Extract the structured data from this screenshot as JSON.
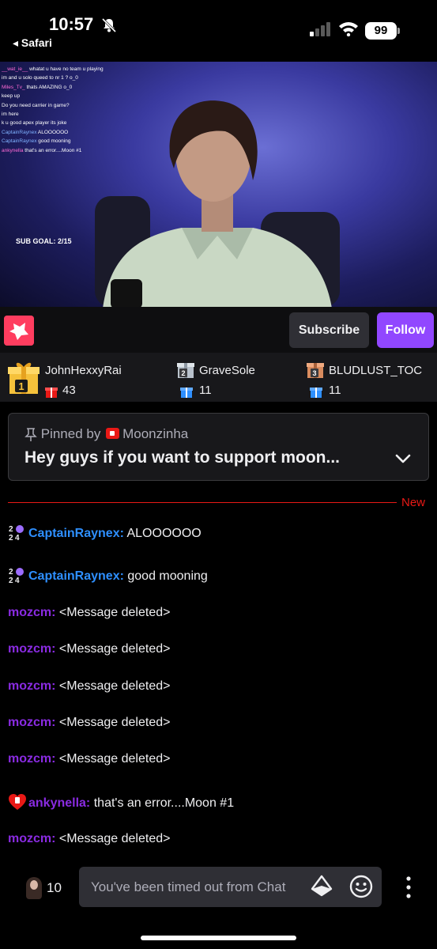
{
  "status_bar": {
    "time": "10:57",
    "back_label": "◂ Safari",
    "battery": "99"
  },
  "video": {
    "overlay_chat": [
      {
        "user": "__wat_ie__",
        "text": "whatat u have no team u playing",
        "style": "vn"
      },
      {
        "user": "",
        "text": "im and u solo queed to nr 1 ? o_0",
        "style": ""
      },
      {
        "user": "Miles_Tv_",
        "text": "thats AMAZING o_0",
        "style": "vn"
      },
      {
        "user": "",
        "text": "keep up",
        "style": ""
      },
      {
        "user": "",
        "text": "Do you need carrier in game?",
        "style": "vn"
      },
      {
        "user": "",
        "text": "im here",
        "style": "vn"
      },
      {
        "user": "",
        "text": "k u good apex player its joke",
        "style": "vn"
      },
      {
        "user": "CaptainRaynex",
        "text": "ALOOOOOO",
        "style": "vb"
      },
      {
        "user": "CaptainRaynex",
        "text": "good mooning",
        "style": "vb"
      },
      {
        "user": "ankynella",
        "text": "that's an error....Moon #1",
        "style": "vn"
      }
    ],
    "sub_goal": "SUB GOAL: 2/15"
  },
  "channel_bar": {
    "subscribe_label": "Subscribe",
    "follow_label": "Follow",
    "accent": "#9147ff"
  },
  "gifters": [
    {
      "rank": "1",
      "name": "JohnHexxyRai",
      "count": "43"
    },
    {
      "rank": "2",
      "name": "GraveSole",
      "count": "11"
    },
    {
      "rank": "3",
      "name": "BLUDLUST_TOC",
      "count": "11"
    }
  ],
  "pinned": {
    "pinned_by_label": "Pinned by",
    "user": "Moonzinha",
    "message": "Hey guys if you want to support moon..."
  },
  "new_label": "New",
  "chat": [
    {
      "user": "CaptainRaynex:",
      "text": "ALOOOOOO",
      "color": "blue",
      "badge": "24"
    },
    {
      "user": "CaptainRaynex:",
      "text": "good mooning",
      "color": "blue",
      "badge": "24"
    },
    {
      "user": "mozcm:",
      "text": "<Message deleted>",
      "color": "purple",
      "badge": ""
    },
    {
      "user": "mozcm:",
      "text": "<Message deleted>",
      "color": "purple",
      "badge": ""
    },
    {
      "user": "mozcm:",
      "text": "<Message deleted>",
      "color": "purple",
      "badge": ""
    },
    {
      "user": "mozcm:",
      "text": "<Message deleted>",
      "color": "purple",
      "badge": ""
    },
    {
      "user": "mozcm:",
      "text": "<Message deleted>",
      "color": "purple",
      "badge": ""
    },
    {
      "user": "ankynella:",
      "text": "that's an error....Moon #1",
      "color": "purple",
      "badge": "heart"
    },
    {
      "user": "mozcm:",
      "text": "<Message deleted>",
      "color": "purple",
      "badge": ""
    }
  ],
  "bottom_bar": {
    "viewer_count": "10",
    "input_placeholder": "You've been timed out from Chat"
  }
}
